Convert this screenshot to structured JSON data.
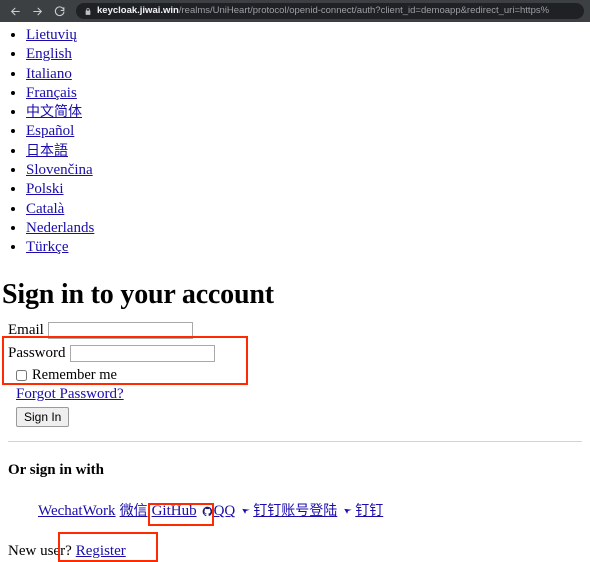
{
  "browser": {
    "back_icon": "back-arrow-icon",
    "forward_icon": "forward-arrow-icon",
    "reload_icon": "reload-icon",
    "lock_icon": "lock-icon",
    "url_host": "keycloak.jiwai.win",
    "url_path": "/realms/UniHeart/protocol/openid-connect/auth?client_id=demoapp&redirect_uri=https%",
    "url_full": "keycloak.jiwai.win/realms/UniHeart/protocol/openid-connect/auth?client_id=demoapp&redirect_uri=https%"
  },
  "languages": [
    {
      "label": "Lietuvių",
      "cjk": false
    },
    {
      "label": "English",
      "cjk": false
    },
    {
      "label": "Italiano",
      "cjk": false
    },
    {
      "label": "Français",
      "cjk": false
    },
    {
      "label": "中文简体",
      "cjk": true
    },
    {
      "label": "Español",
      "cjk": false
    },
    {
      "label": "日本語",
      "cjk": true
    },
    {
      "label": "Slovenčina",
      "cjk": false
    },
    {
      "label": "Polski",
      "cjk": false
    },
    {
      "label": "Català",
      "cjk": false
    },
    {
      "label": "Nederlands",
      "cjk": false
    },
    {
      "label": "Türkçe",
      "cjk": false
    }
  ],
  "login": {
    "title": "Sign in to your account",
    "email_label": "Email",
    "email_value": "",
    "password_label": "Password",
    "password_value": "",
    "remember_label": "Remember me",
    "remember_checked": false,
    "forgot_label": "Forgot Password?",
    "signin_label": "Sign In"
  },
  "social": {
    "heading": "Or sign in with",
    "providers": [
      {
        "label": "WechatWork",
        "cjk": false,
        "icon": ""
      },
      {
        "label": "微信",
        "cjk": true,
        "icon": ""
      },
      {
        "label": "GitHub",
        "cjk": false,
        "icon": "github-icon"
      },
      {
        "label": "QQ",
        "cjk": false,
        "icon": "arrow-icon"
      },
      {
        "label": "钉钉账号登陆",
        "cjk": true,
        "icon": "arrow-icon"
      },
      {
        "label": "钉钉",
        "cjk": true,
        "icon": ""
      }
    ]
  },
  "footer": {
    "new_user_text": "New user?",
    "register_label": "Register"
  },
  "annotations": {
    "highlight_color": "#ff2a00",
    "boxes": [
      "credentials-highlight",
      "github-highlight",
      "register-highlight"
    ]
  },
  "colors": {
    "link": "#1a0dab",
    "chrome_bg": "#3c4043",
    "omnibox_bg": "#202124",
    "highlight": "#ff2a00"
  }
}
